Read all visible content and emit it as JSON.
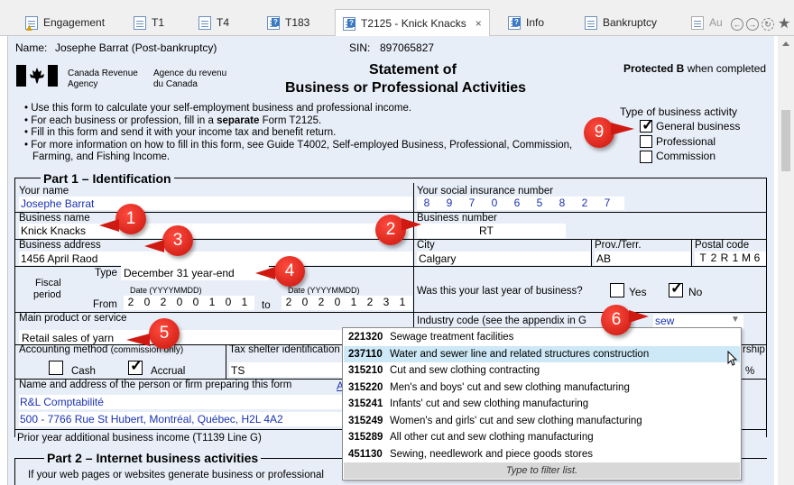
{
  "tabs": [
    {
      "label": "Engagement",
      "warn": true
    },
    {
      "label": "T1"
    },
    {
      "label": "T4"
    },
    {
      "label": "T183",
      "q": true
    },
    {
      "label": "T2125 - Knick Knacks",
      "q": true,
      "active": true,
      "close": "×"
    },
    {
      "label": "Info",
      "q": true
    },
    {
      "label": "Bankruptcy"
    },
    {
      "label": "Au"
    }
  ],
  "header": {
    "name_label": "Name:",
    "name_value": "Josephe Barrat (Post-bankruptcy)",
    "sin_label": "SIN:",
    "sin_value": "897065827",
    "agency_en_1": "Canada Revenue",
    "agency_en_2": "Agency",
    "agency_fr_1": "Agence du revenu",
    "agency_fr_2": "du Canada",
    "title_1": "Statement of",
    "title_2": "Business or Professional Activities",
    "protected": "Protected B",
    "protected_suffix": "when completed",
    "bullets": [
      "Use this form to calculate your self-employment business and professional income.",
      "For each business or profession, fill in a",
      "separate",
      "Form T2125.",
      "Fill in this form and send it with your income tax and benefit return.",
      "For more information on how to fill in this form, see Guide T4002, Self-employed Business, Professional, Commission,",
      "Farming, and Fishing Income."
    ],
    "type_title": "Type of business activity",
    "types": [
      {
        "label": "General business",
        "checked": true
      },
      {
        "label": "Professional",
        "checked": false
      },
      {
        "label": "Commission",
        "checked": false
      }
    ]
  },
  "part1": {
    "title": "Part 1 – Identification",
    "your_name_label": "Your name",
    "your_name": "Josephe Barrat",
    "sin_label": "Your social insurance number",
    "sin_digits": [
      "8",
      "9",
      "7",
      "0",
      "6",
      "5",
      "8",
      "2",
      "7"
    ],
    "business_name_label": "Business name",
    "business_name": "Knick Knacks",
    "business_number_label": "Business number",
    "business_number": "RT",
    "address_label": "Business address",
    "address": "1456 April Raod",
    "city_label": "City",
    "city": "Calgary",
    "prov_label": "Prov./Terr.",
    "prov": "AB",
    "postal_label": "Postal code",
    "postal": [
      "T",
      "2",
      "R",
      "1",
      "M",
      "6"
    ],
    "fiscal_1": "Fiscal",
    "fiscal_2": "period",
    "type_label": "Type",
    "type_value": "December 31 year-end",
    "date_fmt": "Date (YYYYMMDD)",
    "from_label": "From",
    "from_digits": [
      "2",
      "0",
      "2",
      "0",
      "0",
      "1",
      "0",
      "1"
    ],
    "to_label": "to",
    "to_digits": [
      "2",
      "0",
      "2",
      "0",
      "1",
      "2",
      "3",
      "1"
    ],
    "last_year_q": "Was this your last year of business?",
    "yes": "Yes",
    "no": "No",
    "product_label": "Main product or service",
    "product": "Retail sales of yarn",
    "industry_label": "Industry code (see the appendix in G",
    "industry_value": "sew",
    "accounting_label": "Accounting method",
    "accounting_note": "(commission only)",
    "cash": "Cash",
    "accrual": "Accrual",
    "tax_shelter_label": "Tax shelter identification",
    "tax_shelter": "TS",
    "partnership_frag": "rship",
    "percent": "%",
    "preparer_label": "Name and address of the person or firm preparing this form",
    "preparer_link": "A",
    "preparer_name": "R&L Comptabilité",
    "preparer_address": "500 - 7766 Rue St Hubert, Montréal, Québec, H2L 4A2",
    "prior_year": "Prior year additional business income (T1139 Line G)"
  },
  "part2": {
    "title": "Part 2 – Internet business activities",
    "text": "If your web pages or websites generate business or professional"
  },
  "dropdown": {
    "options": [
      {
        "code": "221320",
        "desc": "Sewage treatment facilities"
      },
      {
        "code": "237110",
        "desc": "Water and sewer line and related structures construction",
        "selected": true
      },
      {
        "code": "315210",
        "desc": "Cut and sew clothing contracting"
      },
      {
        "code": "315220",
        "desc": "Men's and boys' cut and sew clothing manufacturing"
      },
      {
        "code": "315241",
        "desc": "Infants' cut and sew clothing manufacturing"
      },
      {
        "code": "315249",
        "desc": "Women's and girls' cut and sew clothing manufacturing"
      },
      {
        "code": "315289",
        "desc": "All other cut and sew clothing manufacturing"
      },
      {
        "code": "451130",
        "desc": "Sewing, needlework and piece goods stores"
      }
    ],
    "footer": "Type to filter list."
  },
  "callouts": [
    "1",
    "2",
    "3",
    "4",
    "5",
    "6",
    "9"
  ],
  "colors": {
    "field_text": "#1a33b3",
    "callout": "#d92018",
    "form_bg": "#e8eef8"
  }
}
